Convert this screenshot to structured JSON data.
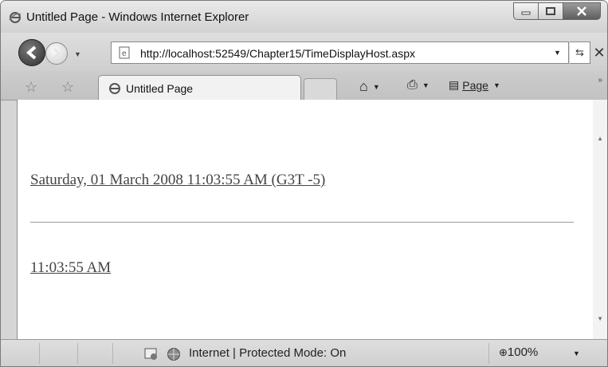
{
  "window": {
    "title": "Untitled Page - Windows Internet Explorer"
  },
  "nav": {
    "url": "http://localhost:52549/Chapter15/TimeDisplayHost.aspx"
  },
  "tabbar": {
    "tab_label": "Untitled Page",
    "page_menu": "Page"
  },
  "page": {
    "date_time": "Saturday, 01 March 2008 11:03:55 AM (G3T -5)",
    "time": "11:03:55 AM"
  },
  "status": {
    "zone": "Internet | Protected Mode: On",
    "zoom": "100%"
  }
}
